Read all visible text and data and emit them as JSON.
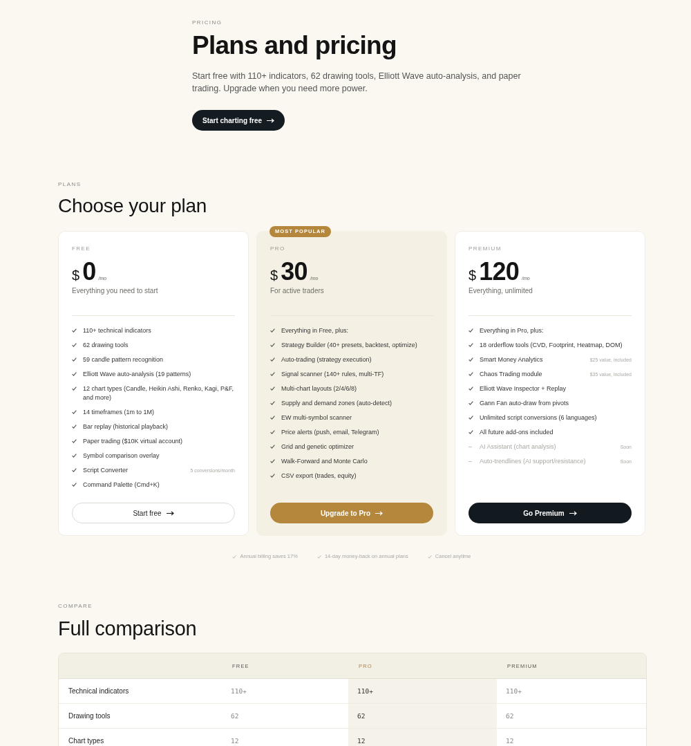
{
  "hero": {
    "eyebrow": "PRICING",
    "title": "Plans and pricing",
    "description": "Start free with 110+ indicators, 62 drawing tools, Elliott Wave auto-analysis, and paper trading. Upgrade when you need more power.",
    "button": {
      "label": "Start charting free"
    }
  },
  "plans_section": {
    "eyebrow": "PLANS",
    "title": "Choose your plan",
    "plans": [
      {
        "name": "FREE",
        "currency": "$",
        "price": "0",
        "period": "/mo",
        "tagline": "Everything you need to start",
        "highlighted": false,
        "features": [
          {
            "text": "110+ technical indicators",
            "kind": "included"
          },
          {
            "text": "62 drawing tools",
            "kind": "included"
          },
          {
            "text": "59 candle pattern recognition",
            "kind": "included"
          },
          {
            "text": "Elliott Wave auto-analysis (19 patterns)",
            "kind": "included"
          },
          {
            "text": "12 chart types (Candle, Heikin Ashi, Renko, Kagi, P&F, and more)",
            "kind": "included"
          },
          {
            "text": "14 timeframes (1m to 1M)",
            "kind": "included"
          },
          {
            "text": "Bar replay (historical playback)",
            "kind": "included"
          },
          {
            "text": "Paper trading ($10K virtual account)",
            "kind": "included"
          },
          {
            "text": "Symbol comparison overlay",
            "kind": "included"
          },
          {
            "text": "Script Converter",
            "note": "5 conversions/month",
            "kind": "included"
          },
          {
            "text": "Command Palette (Cmd+K)",
            "kind": "included"
          }
        ],
        "button": {
          "label": "Start free",
          "kind": "outline"
        }
      },
      {
        "badge": "MOST POPULAR",
        "name": "PRO",
        "currency": "$",
        "price": "30",
        "period": "/mo",
        "tagline": "For active traders",
        "highlighted": true,
        "features": [
          {
            "text": "Everything in Free, plus:",
            "kind": "included"
          },
          {
            "text": "Strategy Builder (40+ presets, backtest, optimize)",
            "kind": "included"
          },
          {
            "text": "Auto-trading (strategy execution)",
            "kind": "included"
          },
          {
            "text": "Signal scanner (140+ rules, multi-TF)",
            "kind": "included"
          },
          {
            "text": "Multi-chart layouts (2/4/6/8)",
            "kind": "included"
          },
          {
            "text": "Supply and demand zones (auto-detect)",
            "kind": "included"
          },
          {
            "text": "EW multi-symbol scanner",
            "kind": "included"
          },
          {
            "text": "Price alerts (push, email, Telegram)",
            "kind": "included"
          },
          {
            "text": "Grid and genetic optimizer",
            "kind": "included"
          },
          {
            "text": "Walk-Forward and Monte Carlo",
            "kind": "included"
          },
          {
            "text": "CSV export (trades, equity)",
            "kind": "included"
          }
        ],
        "button": {
          "label": "Upgrade to Pro",
          "kind": "accent"
        }
      },
      {
        "name": "PREMIUM",
        "currency": "$",
        "price": "120",
        "period": "/mo",
        "tagline": "Everything, unlimited",
        "highlighted": false,
        "features": [
          {
            "text": "Everything in Pro, plus:",
            "kind": "included"
          },
          {
            "text": "18 orderflow tools (CVD, Footprint, Heatmap, DOM)",
            "kind": "included"
          },
          {
            "text": "Smart Money Analytics",
            "note": "$25 value, included",
            "kind": "included"
          },
          {
            "text": "Chaos Trading module",
            "note": "$35 value, included",
            "kind": "included"
          },
          {
            "text": "Elliott Wave Inspector + Replay",
            "kind": "included"
          },
          {
            "text": "Gann Fan auto-draw from pivots",
            "kind": "included"
          },
          {
            "text": "Unlimited script conversions (6 languages)",
            "kind": "included"
          },
          {
            "text": "All future add-ons included",
            "kind": "included"
          },
          {
            "text": "AI Assistant (chart analysis)",
            "note": "Soon",
            "kind": "soon"
          },
          {
            "text": "Auto-trendlines (AI support/resistance)",
            "note": "Soon",
            "kind": "soon"
          }
        ],
        "button": {
          "label": "Go Premium",
          "kind": "dark"
        }
      }
    ],
    "notes": [
      "Annual billing saves 17%",
      "14-day money-back on annual plans",
      "Cancel anytime"
    ]
  },
  "comparison": {
    "eyebrow": "COMPARE",
    "title": "Full comparison",
    "columns": [
      {
        "label": "FREE",
        "highlighted": false
      },
      {
        "label": "PRO",
        "highlighted": true
      },
      {
        "label": "PREMIUM",
        "highlighted": false
      }
    ],
    "rows": [
      {
        "feature": "Technical indicators",
        "values": [
          "110+",
          "110+",
          "110+"
        ]
      },
      {
        "feature": "Drawing tools",
        "values": [
          "62",
          "62",
          "62"
        ]
      },
      {
        "feature": "Chart types",
        "values": [
          "12",
          "12",
          "12"
        ]
      }
    ]
  }
}
